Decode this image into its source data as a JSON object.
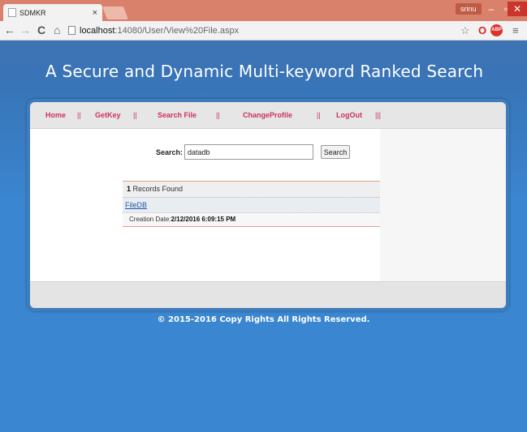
{
  "browser": {
    "tab_title": "SDMKR",
    "tab_close": "×",
    "user_badge": "srinu",
    "window_min": "–",
    "window_max": "▫",
    "window_close": "✕",
    "url_host": "localhost",
    "url_rest": ":14080/User/View%20File.aspx",
    "icons": [
      "back-arrow-icon",
      "forward-arrow-icon",
      "reload-icon",
      "home-icon",
      "page-icon",
      "star-icon",
      "opera-icon",
      "adblock-icon",
      "menu-icon"
    ]
  },
  "site": {
    "title": "A Secure and Dynamic Multi-keyword Ranked Search",
    "copyright": "© 2015-2016 Copy Rights All Rights Reserved."
  },
  "menu": {
    "lead_sep": "||",
    "items": [
      {
        "label": "Home",
        "sep": "||"
      },
      {
        "label": "GetKey",
        "sep": "||"
      },
      {
        "label": "Search File",
        "sep": "||"
      },
      {
        "label": "ChangeProfile",
        "sep": "||"
      },
      {
        "label": "LogOut",
        "sep": "|||"
      }
    ]
  },
  "search": {
    "label": "Search:",
    "value": "datadb",
    "button": "Search"
  },
  "results": {
    "count": "1",
    "count_suffix": " Records Found",
    "link": "FileDB",
    "date_label": "Creation Date:",
    "date_value": "2/12/2016 6:09:15 PM"
  },
  "colors": {
    "titlebar": "#d9816a",
    "page_background": "#3a86d0",
    "menu_text": "#cc3355"
  }
}
